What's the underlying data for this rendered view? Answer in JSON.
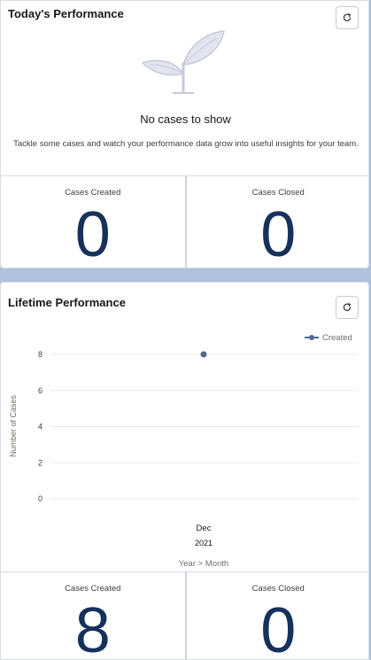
{
  "today": {
    "title": "Today's Performance",
    "refresh_icon": "refresh-icon",
    "empty_title": "No cases to show",
    "empty_description": "Tackle some cases and watch your performance data grow into useful insights for your team.",
    "stats": [
      {
        "label": "Cases Created",
        "value": "0"
      },
      {
        "label": "Cases Closed",
        "value": "0"
      }
    ]
  },
  "lifetime": {
    "title": "Lifetime Performance",
    "refresh_icon": "refresh-icon",
    "stats": [
      {
        "label": "Cases Created",
        "value": "8"
      },
      {
        "label": "Cases Closed",
        "value": "0"
      }
    ]
  },
  "colors": {
    "accent": "#16325c",
    "point": "#54698d",
    "grid": "#e5e9ef"
  },
  "chart_data": {
    "type": "line",
    "x": [
      "Dec 2021"
    ],
    "x_tick_label_top": "Dec",
    "x_tick_label_bottom": "2021",
    "series": [
      {
        "name": "Created",
        "values": [
          8
        ]
      }
    ],
    "xlabel": "Year > Month",
    "ylabel": "Number of Cases",
    "yticks": [
      0,
      2,
      4,
      6,
      8
    ],
    "ylim": [
      0,
      8
    ],
    "legend_position": "top-right",
    "grid": true
  }
}
